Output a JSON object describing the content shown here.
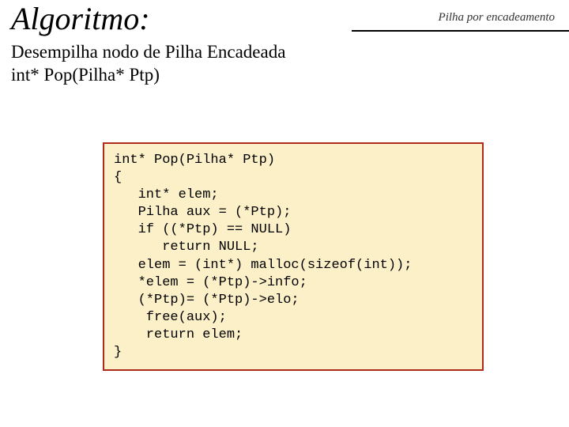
{
  "header": {
    "title": "Algoritmo:",
    "topic": "Pilha por encadeamento"
  },
  "subtitle": {
    "line1": "Desempilha nodo de Pilha Encadeada",
    "line2": "int* Pop(Pilha* Ptp)"
  },
  "code": {
    "l1": "int* Pop(Pilha* Ptp)",
    "l2": "{",
    "l3": "   int* elem;",
    "l4": "   Pilha aux = (*Ptp);",
    "l5": "   if ((*Ptp) == NULL)",
    "l6": "      return NULL;",
    "l7": "   elem = (int*) malloc(sizeof(int));",
    "l8": "   *elem = (*Ptp)->info;",
    "l9": "   (*Ptp)= (*Ptp)->elo;",
    "l10": "    free(aux);",
    "l11": "    return elem;",
    "l12": "}"
  }
}
